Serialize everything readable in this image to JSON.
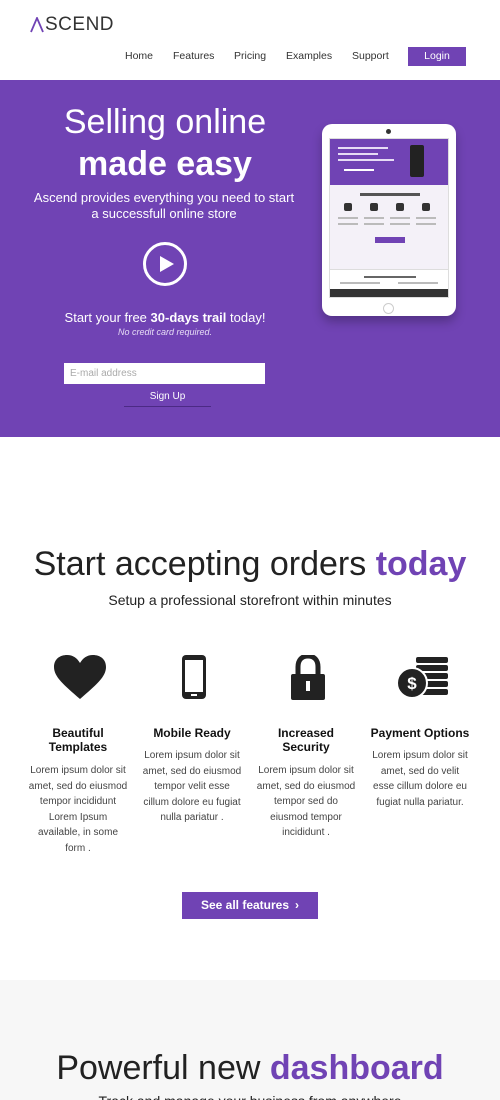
{
  "brand": {
    "logo_text": "SCEND",
    "accent_color": "#7043b4"
  },
  "nav": {
    "items": [
      {
        "label": "Home"
      },
      {
        "label": "Features"
      },
      {
        "label": "Pricing"
      },
      {
        "label": "Examples"
      },
      {
        "label": "Support"
      }
    ],
    "login_label": "Login"
  },
  "hero": {
    "title_line1": "Selling online",
    "title_line2": "made easy",
    "description": "Ascend provides everything you need to start a successfull online store",
    "trial_prefix": "Start your free ",
    "trial_bold": "30-days trail",
    "trial_suffix": " today!",
    "no_credit": "No credit card required.",
    "email_placeholder": "E-mail address",
    "signup_label": "Sign Up"
  },
  "features": {
    "title_plain": "Start accepting orders ",
    "title_accent": "today",
    "subtitle": "Setup a professional storefront within minutes",
    "items": [
      {
        "icon": "heart-icon",
        "name": "Beautiful Templates",
        "desc": "Lorem ipsum dolor sit amet, sed do eiusmod tempor incididunt Lorem Ipsum available, in some form ."
      },
      {
        "icon": "mobile-phone-icon",
        "name": "Mobile Ready",
        "desc": "Lorem ipsum dolor sit amet, sed do eiusmod tempor velit esse cillum dolore eu fugiat nulla pariatur ."
      },
      {
        "icon": "lock-icon",
        "name": "Increased Security",
        "desc": "Lorem ipsum dolor sit amet, sed do eiusmod tempor sed do eiusmod tempor incididunt ."
      },
      {
        "icon": "dollar-coins-icon",
        "name": "Payment Options",
        "desc": "Lorem ipsum dolor sit amet, sed do velit esse cillum dolore eu fugiat nulla pariatur."
      }
    ],
    "see_all_label": "See all features",
    "see_all_chevron": "›"
  },
  "dashboard": {
    "title_plain": "Powerful new ",
    "title_accent": "dashboard",
    "subtitle": "Track and manage your business from anywhere"
  }
}
